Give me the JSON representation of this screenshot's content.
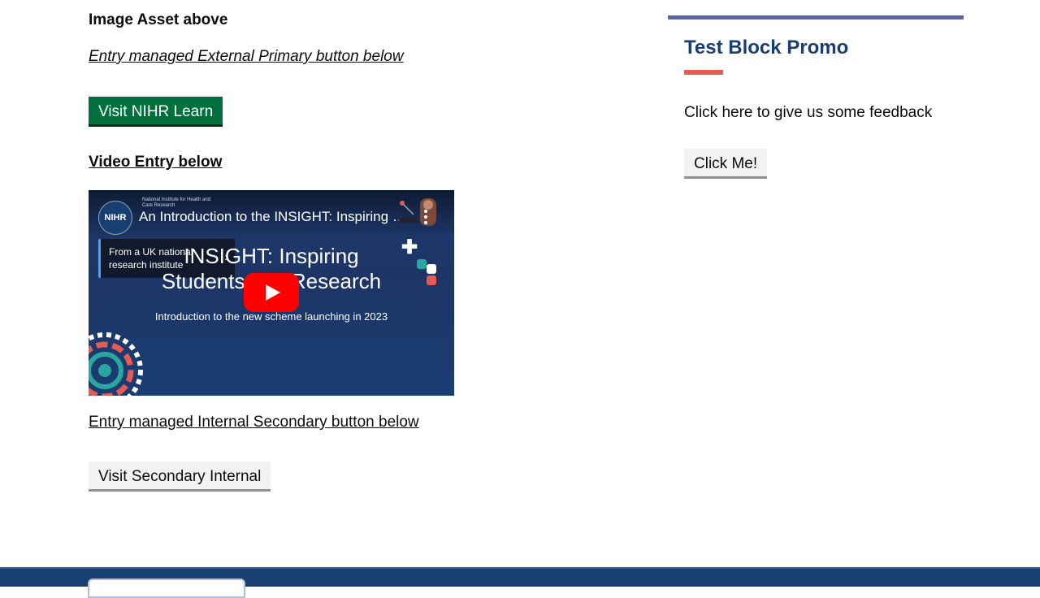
{
  "main": {
    "image_asset_label": "Image Asset above",
    "primary_intro": "Entry managed External Primary button below",
    "primary_button": "Visit NIHR Learn",
    "video_heading": "Video Entry below",
    "video": {
      "channel_logo": "NIHR",
      "channel_tagline": "National Institute for Health and Care Research",
      "title": "An Introduction to the INSIGHT: Inspiring Students into Research",
      "info_card": "From a UK national research institute",
      "big_title_line1": "INSIGHT: Inspiring",
      "big_title_line2": "Students into Research",
      "subtitle": "Introduction to the new scheme launching in 2023",
      "play_icon": "youtube-play-icon"
    },
    "secondary_intro": "Entry managed Internal Secondary button below",
    "secondary_button": "Visit Secondary Internal"
  },
  "promo": {
    "title": "Test Block Promo",
    "text": "Click here to give us some feedback",
    "button": "Click Me!"
  },
  "colors": {
    "primary_button": "#00703c",
    "promo_border": "#5d64a6",
    "promo_title": "#193e72",
    "promo_accent": "#e35b52",
    "footer": "#193e72"
  }
}
